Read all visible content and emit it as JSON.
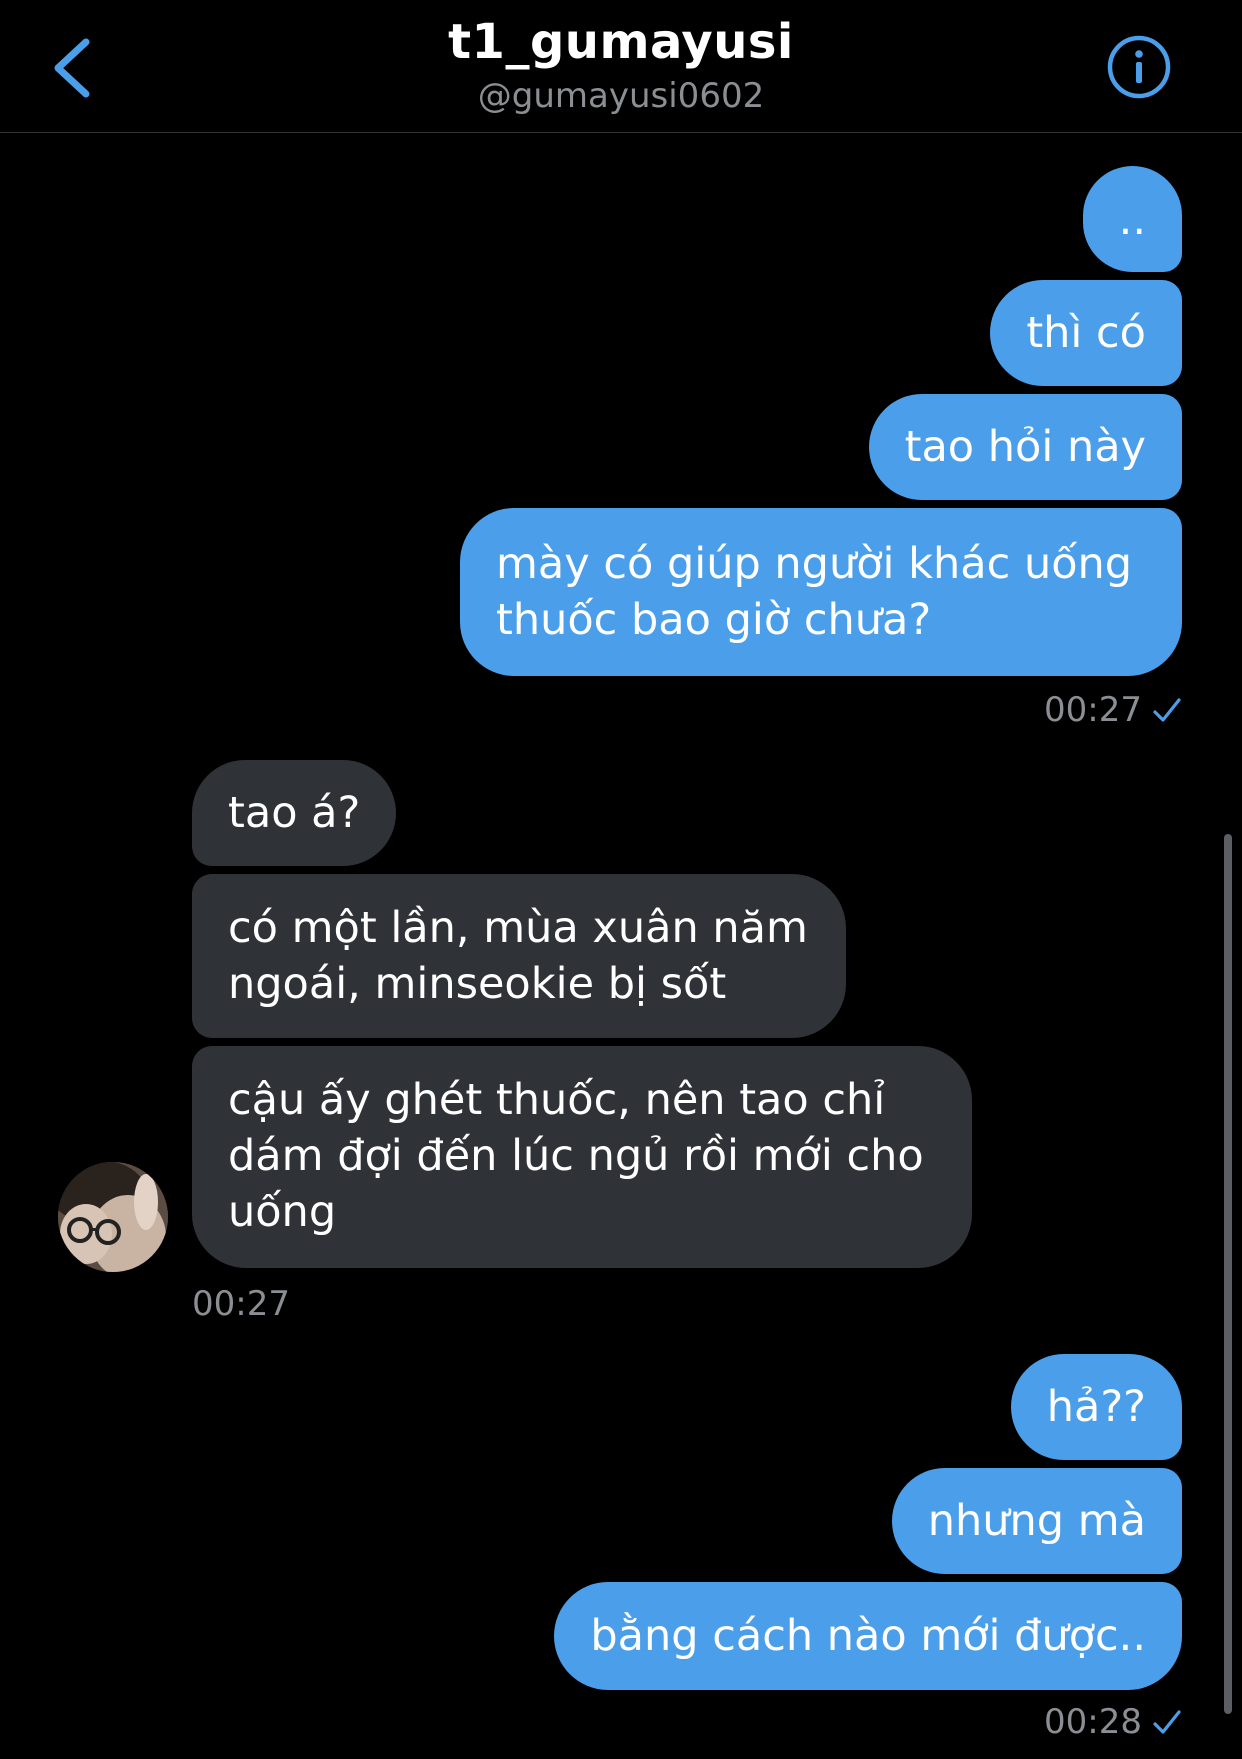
{
  "header": {
    "title": "t1_gumayusi",
    "handle": "@gumayusi0602"
  },
  "messages": {
    "group1": [
      "..",
      "thì có",
      "tao hỏi này",
      "mày có giúp người khác uống thuốc bao giờ chưa?"
    ],
    "group1_time": "00:27",
    "group2": [
      "tao á?",
      "có một lần, mùa xuân năm ngoái, minseokie bị sốt",
      "cậu ấy ghét thuốc, nên tao chỉ dám đợi đến lúc ngủ rồi mới cho uống"
    ],
    "group2_time": "00:27",
    "group3": [
      "hả??",
      "nhưng mà",
      "bằng cách nào mới được.."
    ],
    "group3_time": "00:28"
  },
  "colors": {
    "outgoing_bubble": "#4b9ee9",
    "incoming_bubble": "#2f3236",
    "accent": "#4b9ee9",
    "background": "#000000",
    "timestamp": "#8b8f93"
  },
  "icons": {
    "back": "chevron-left-icon",
    "info": "info-circle-icon",
    "read": "check-icon"
  }
}
